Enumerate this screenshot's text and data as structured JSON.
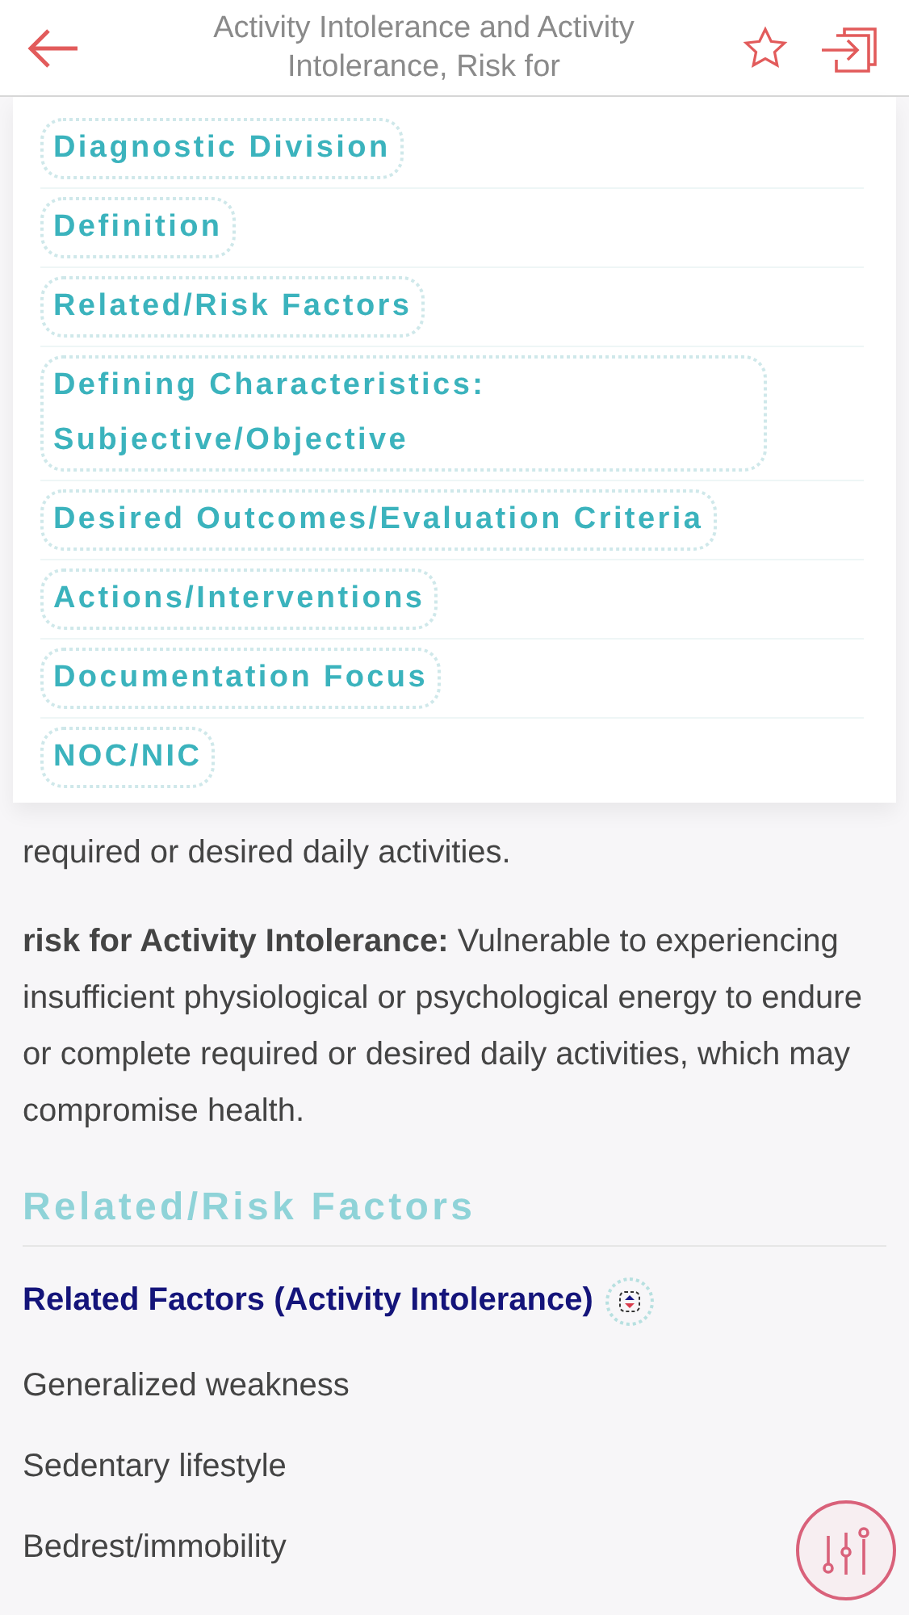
{
  "header": {
    "title": "Activity Intolerance and Activity Intolerance, Risk for"
  },
  "menu": {
    "items": [
      {
        "label": "Diagnostic Division"
      },
      {
        "label": "Definition"
      },
      {
        "label": "Related/Risk Factors"
      },
      {
        "label": "Defining Characteristics: Subjective/Objective"
      },
      {
        "label": "Desired Outcomes/Evaluation Criteria"
      },
      {
        "label": "Actions/Interventions"
      },
      {
        "label": "Documentation Focus"
      },
      {
        "label": "NOC/NIC"
      }
    ]
  },
  "content": {
    "paragraphs": [
      "required or desired daily activities.",
      "**risk for Activity Intolerance:** Vulnerable to experiencing insufficient physiological or psychological energy to endure or complete required or desired daily activities, which may compromise health."
    ],
    "section_heading": "Related/Risk Factors",
    "subheading": "Related Factors (Activity Intolerance)",
    "factors": [
      "Generalized weakness",
      "Sedentary lifestyle",
      "Bedrest/immobility"
    ]
  }
}
